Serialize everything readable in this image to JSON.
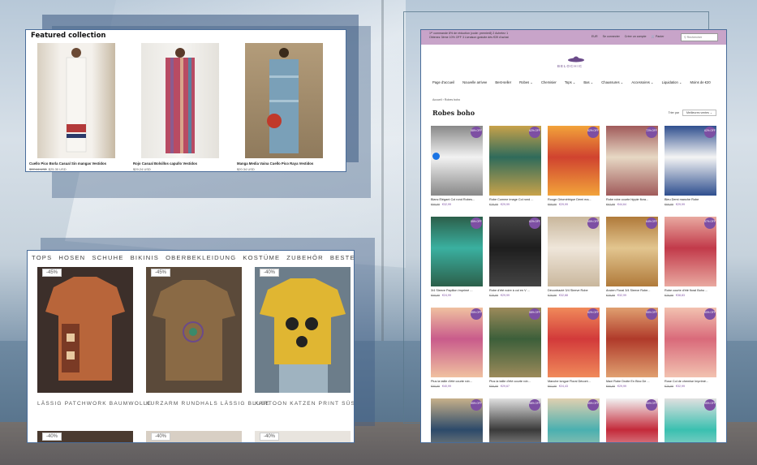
{
  "featured": {
    "title": "Featured collection",
    "items": [
      {
        "name": "Cuello Pico Borla Casual Sin mangas Vestidos",
        "old_price": "$37.44 USD",
        "price": "$25.30 USD",
        "colors": [
          "#f4f1ec",
          "#b33a3a",
          "#2b3a6a"
        ]
      },
      {
        "name": "Rojo Casual Bolsillos capullo Vestidos",
        "old_price": "",
        "price": "$29.24 USD",
        "colors": [
          "#b84b63",
          "#8b5b8f",
          "#d9a58a"
        ]
      },
      {
        "name": "Manga Media Vaina Cuello Pico Raya Vestidos",
        "old_price": "",
        "price": "$20.34 USD",
        "colors": [
          "#7aa0b8",
          "#a8c4d4",
          "#c0392b"
        ]
      }
    ]
  },
  "de_shop": {
    "nav": [
      "TOPS",
      "HOSEN",
      "SCHUHE",
      "BIKINIS",
      "OBERBEKLEIDUNG",
      "KOSTÜME",
      "ZUBEHÖR",
      "BESTELLVERFOLGUNG"
    ],
    "items": [
      {
        "badge": "-45%",
        "name": "LÄSSIG PATCHWORK BAUMWOLLE",
        "colors": [
          "#b8653a",
          "#3c2f2a"
        ]
      },
      {
        "badge": "-45%",
        "name": "KURZARM RUNDHALS LÄSSIG BLUSE",
        "colors": [
          "#8a6a45",
          "#5b4a3a"
        ]
      },
      {
        "badge": "-40%",
        "name": "KARTOON KATZEN PRINT SÜSS",
        "colors": [
          "#e0b632",
          "#6c7d8a"
        ]
      }
    ],
    "second_row_badges": [
      "-40%",
      "-40%",
      "-40%"
    ]
  },
  "fr_shop": {
    "promo": "1ᵉʳ commande 8% de réduction (code: premier8) 2 Achetez 1 Obtenez 3ème 10% OFF 3 Livraison gratuite dès €39 d'achat",
    "topbar_links": [
      "EUR",
      "Se connecter",
      "Créer un compte",
      "Panier"
    ],
    "search_placeholder": "Rechercher",
    "logo_text": "BELOCHIC",
    "nav": [
      "Page d'accueil",
      "Nouvelle arrivee",
      "Best-seller",
      "Robes",
      "Chemisier",
      "Tops",
      "Bas",
      "Chaussures",
      "Accessoires",
      "Liquidation",
      "Moins de €20"
    ],
    "breadcrumb": "Accueil  ›  Robes boho",
    "heading": "Robes boho",
    "sort_label": "Trier par",
    "sort_value": "Meilleures ventes",
    "products": [
      {
        "badge": "58% OFF",
        "name": "Blanc Élégant Col rond Robes...",
        "old": "€69,99",
        "price": "€32,99",
        "colors": [
          "#f2f2f2",
          "#888"
        ]
      },
      {
        "badge": "62% OFF",
        "name": "Robe Comme image Col rond ...",
        "old": "€78,99",
        "price": "€29,99",
        "colors": [
          "#2f6b5b",
          "#c8a24a"
        ]
      },
      {
        "badge": "62% OFF",
        "name": "Rouge Géométrique Demi ma...",
        "old": "€68,99",
        "price": "€29,99",
        "colors": [
          "#d0432f",
          "#f2a33a"
        ]
      },
      {
        "badge": "72% OFF",
        "name": "Robe robe courte hippie flora...",
        "old": "€62,99",
        "price": "€44,64",
        "colors": [
          "#e7d8c4",
          "#a05a5a"
        ]
      },
      {
        "badge": "62% OFF",
        "name": "Bleu Demi manche Robe",
        "old": "€68,99",
        "price": "€29,99",
        "colors": [
          "#f4f4f4",
          "#2f4f8f"
        ]
      },
      {
        "badge": "55% OFF",
        "name": "3/4 Sleeve Papillon Imprimé ...",
        "old": "€68,99",
        "price": "€24,99",
        "colors": [
          "#3ab0a0",
          "#2c5f4a"
        ]
      },
      {
        "badge": "62% OFF",
        "name": "Robe d'été noire à col en V ...",
        "old": "€78,99",
        "price": "€29,99",
        "colors": [
          "#1e1e1e",
          "#444"
        ]
      },
      {
        "badge": "65% OFF",
        "name": "Décontracté 3/4 Sleeve Robe",
        "old": "€79,99",
        "price": "€32,88",
        "colors": [
          "#efe6da",
          "#c9b79c"
        ]
      },
      {
        "badge": "64% OFF",
        "name": "Ancien Floral 3/4 Sleeve Robe...",
        "old": "€79,99",
        "price": "€32,99",
        "colors": [
          "#e2c58f",
          "#b07a3a"
        ]
      },
      {
        "badge": "57% OFF",
        "name": "Robe courte d'été floral Boho ...",
        "old": "€79,99",
        "price": "€38,83",
        "colors": [
          "#c23a4a",
          "#e9a9a0"
        ]
      },
      {
        "badge": "55% OFF",
        "name": "Plus la taille d'été courte rob...",
        "old": "€98,99",
        "price": "€40,99",
        "colors": [
          "#c95b8b",
          "#f0c1a0"
        ]
      },
      {
        "badge": "58% OFF",
        "name": "Plus la taille d'été courte rob...",
        "old": "€59,99",
        "price": "€29,67",
        "colors": [
          "#3c5f3a",
          "#9c8a5a"
        ]
      },
      {
        "badge": "62% OFF",
        "name": "Manche longue Floral Décont...",
        "old": "€62,99",
        "price": "€24,43",
        "colors": [
          "#d23a3a",
          "#f08a5a"
        ]
      },
      {
        "badge": "55% OFF",
        "name": "Maxi Robe Droite En Bloc De ...",
        "old": "€66,99",
        "price": "€29,99",
        "colors": [
          "#b03a2a",
          "#e0a070"
        ]
      },
      {
        "badge": "60% OFF",
        "name": "Rose Col de chemise Imprimé...",
        "old": "€79,99",
        "price": "€32,99",
        "colors": [
          "#d96a7a",
          "#f2c2b0"
        ]
      },
      {
        "badge": "55% OFF",
        "name": "",
        "old": "",
        "price": "",
        "colors": [
          "#2c4a6a",
          "#c7b08a"
        ]
      },
      {
        "badge": "58% OFF",
        "name": "",
        "old": "",
        "price": "",
        "colors": [
          "#3a3a3a",
          "#e0e0e0"
        ]
      },
      {
        "badge": "55% OFF",
        "name": "",
        "old": "",
        "price": "",
        "colors": [
          "#4ab0b0",
          "#e0d0b0"
        ]
      },
      {
        "badge": "56% OFF",
        "name": "",
        "old": "",
        "price": "",
        "colors": [
          "#c42a3a",
          "#f2f2f2"
        ]
      },
      {
        "badge": "55% OFF",
        "name": "",
        "old": "",
        "price": "",
        "colors": [
          "#3ac0b0",
          "#e0e0e0"
        ]
      }
    ]
  }
}
